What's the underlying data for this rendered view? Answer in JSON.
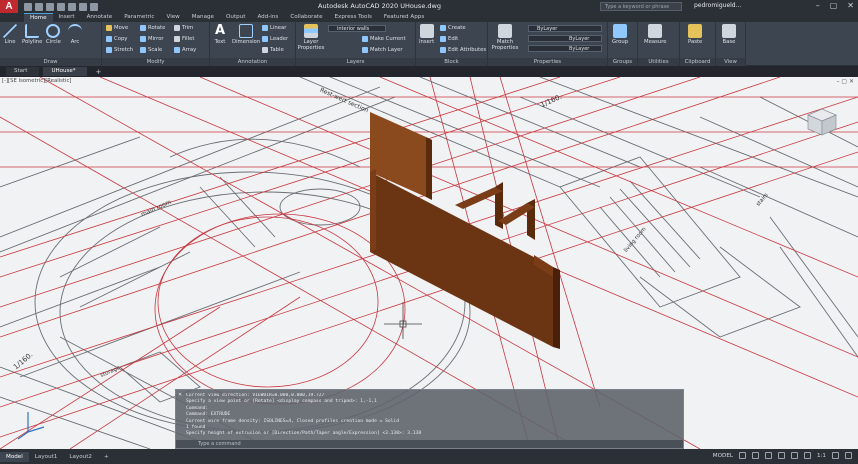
{
  "titlebar": {
    "app_logo": "A",
    "title": "Autodesk AutoCAD 2020   UHouse.dwg",
    "search_placeholder": "Type a keyword or phrase",
    "user": "pedromigueld..."
  },
  "ribbon_tabs": [
    "Home",
    "Insert",
    "Annotate",
    "Parametric",
    "View",
    "Manage",
    "Output",
    "Add-ins",
    "Collaborate",
    "Express Tools",
    "Featured Apps"
  ],
  "ribbon": {
    "draw": {
      "label": "Draw",
      "line": "Line",
      "polyline": "Polyline",
      "circle": "Circle",
      "arc": "Arc"
    },
    "modify": {
      "label": "Modify",
      "move": "Move",
      "rotate": "Rotate",
      "trim": "Trim",
      "copy": "Copy",
      "mirror": "Mirror",
      "fillet": "Fillet",
      "stretch": "Stretch",
      "scale": "Scale",
      "array": "Array"
    },
    "annotation": {
      "label": "Annotation",
      "text": "Text",
      "dimension": "Dimension",
      "linear": "Linear",
      "leader": "Leader",
      "table": "Table"
    },
    "layers": {
      "label": "Layers",
      "layer_properties": "Layer Properties",
      "layer_value": "interior walls",
      "make_current": "Make Current",
      "match_layer": "Match Layer"
    },
    "block": {
      "label": "Block",
      "insert": "Insert",
      "create": "Create",
      "edit": "Edit",
      "edit_attributes": "Edit Attributes"
    },
    "properties": {
      "label": "Properties",
      "match_properties": "Match Properties",
      "color": "ByLayer",
      "linetype": "ByLayer",
      "lineweight": "ByLayer"
    },
    "groups": {
      "label": "Groups",
      "group": "Group"
    },
    "utilities": {
      "label": "Utilities",
      "measure": "Measure"
    },
    "clipboard": {
      "label": "Clipboard",
      "paste": "Paste"
    },
    "view": {
      "label": "View",
      "base": "Base"
    }
  },
  "file_tabs": {
    "start": "Start",
    "uhouse": "UHouse*",
    "plus": "+"
  },
  "viewport": {
    "label": "[-][SE Isometric][Realistic]",
    "plan_texts": [
      "main room",
      "storage",
      "stairs",
      "living room",
      "1/160.",
      "Rest-wert section"
    ]
  },
  "command": {
    "history": [
      "Current view direction: VIEWDIR=0.000,0.000,19.727",
      "Specify a view point or [Rotate] <display compass and tripod>: 1,-1,1",
      "Command:",
      "Command: EXTRUDE",
      "Current wire frame density: ISOLINES=4, Closed profiles creation mode = Solid",
      "1 found",
      "Specify height of extrusion or [Direction/Path/Taper angle/Expression] <3.138>: 3.138"
    ],
    "placeholder": "Type a command"
  },
  "statusbar": {
    "layouts": [
      "Model",
      "Layout1",
      "Layout2"
    ],
    "model": "MODEL",
    "scale": "1:1"
  },
  "colors": {
    "wall": "#6b3412",
    "redline": "#c8373f",
    "accent": "#4aa3df"
  }
}
